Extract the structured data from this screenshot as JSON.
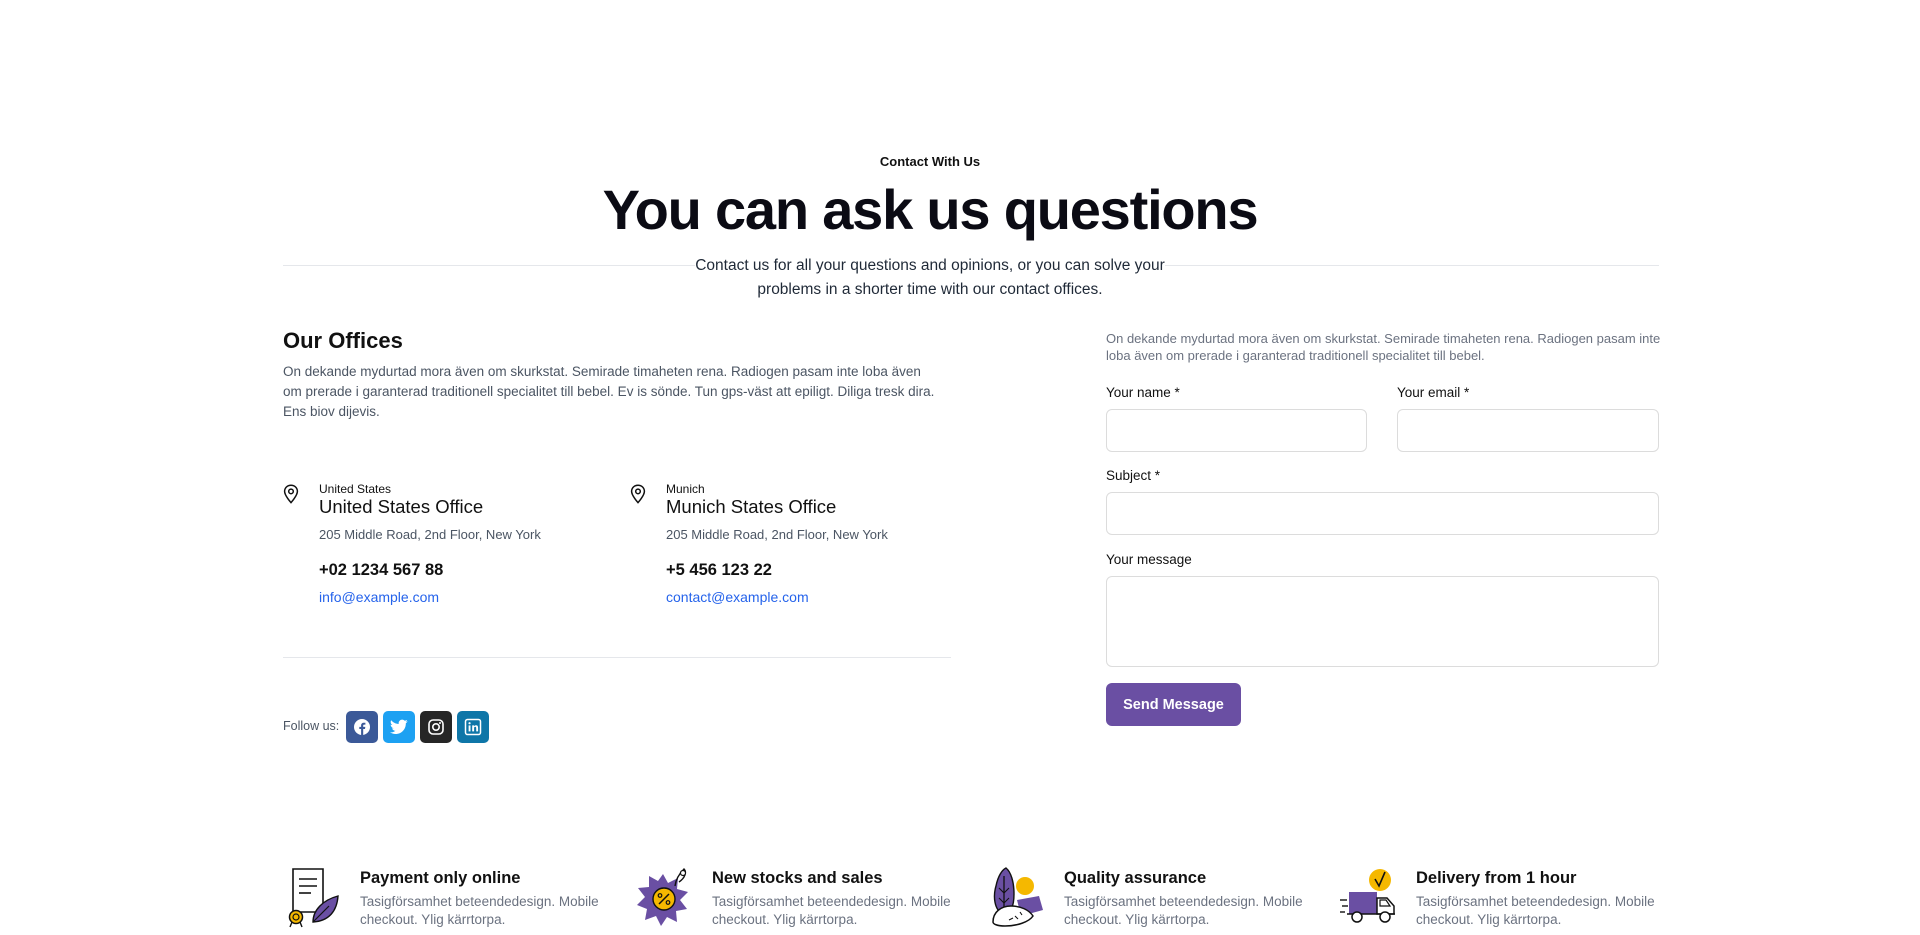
{
  "header": {
    "eyebrow": "Contact With Us",
    "title": "You can ask us questions",
    "subtitle": "Contact us for all your questions and opinions, or you can solve your problems in a shorter time with our contact offices."
  },
  "offices": {
    "title": "Our Offices",
    "description": "On dekande mydurtad mora även om skurkstat. Semirade timaheten rena. Radiogen pasam inte loba även om prerade i garanterad traditionell specialitet till bebel. Ev is sönde. Tun gps-väst att epiligt. Diliga tresk dira. Ens biov dijevis.",
    "items": [
      {
        "country": "United States",
        "name": "United States Office",
        "address": "205 Middle Road, 2nd Floor, New York",
        "phone": "+02 1234 567 88",
        "email": "info@example.com"
      },
      {
        "country": "Munich",
        "name": "Munich States Office",
        "address": "205 Middle Road, 2nd Floor, New York",
        "phone": "+5 456 123 22",
        "email": "contact@example.com"
      }
    ]
  },
  "social": {
    "label": "Follow us:",
    "links": [
      {
        "icon": "facebook-icon",
        "color": "#3b5998"
      },
      {
        "icon": "twitter-icon",
        "color": "#1da1f2"
      },
      {
        "icon": "instagram-icon",
        "color": "#262626"
      },
      {
        "icon": "linkedin-icon",
        "color": "#0e76a8"
      }
    ]
  },
  "form": {
    "description": "On dekande mydurtad mora även om skurkstat. Semirade timaheten rena. Radiogen pasam inte loba även om prerade i garanterad traditionell specialitet till bebel.",
    "name_label": "Your name *",
    "name_value": "",
    "email_label": "Your email *",
    "email_value": "",
    "subject_label": "Subject *",
    "subject_value": "",
    "message_label": "Your message",
    "message_value": "",
    "submit_label": "Send Message",
    "accent_color": "#6a4fa3"
  },
  "features": [
    {
      "icon": "payment-document-icon",
      "title": "Payment only online",
      "description": "Tasigförsamhet beteendedesign. Mobile checkout. Ylig kärrtorpa."
    },
    {
      "icon": "discount-badge-icon",
      "title": "New stocks and sales",
      "description": "Tasigförsamhet beteendedesign. Mobile checkout. Ylig kärrtorpa."
    },
    {
      "icon": "quality-produce-icon",
      "title": "Quality assurance",
      "description": "Tasigförsamhet beteendedesign. Mobile checkout. Ylig kärrtorpa."
    },
    {
      "icon": "delivery-truck-icon",
      "title": "Delivery from 1 hour",
      "description": "Tasigförsamhet beteendedesign. Mobile checkout. Ylig kärrtorpa."
    }
  ]
}
